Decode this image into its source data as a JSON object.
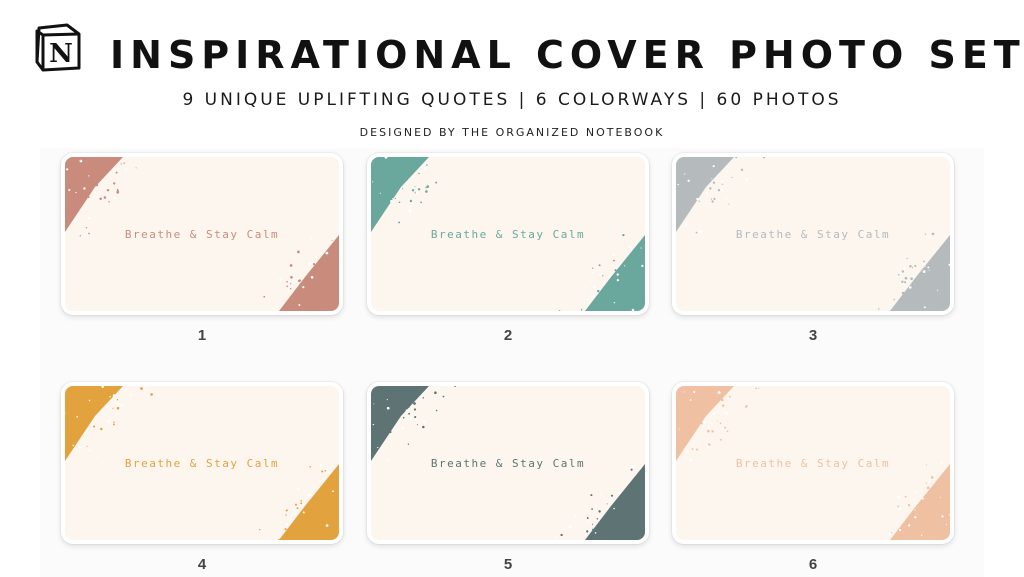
{
  "header": {
    "logo_letter": "N",
    "title": "INSPIRATIONAL COVER PHOTO SET",
    "subtitle": "9 UNIQUE UPLIFTING QUOTES | 6 COLORWAYS | 60 PHOTOS",
    "credit": "DESIGNED BY THE ORGANIZED NOTEBOOK"
  },
  "covers": [
    {
      "number": "1",
      "quote": "Breathe & Stay Calm",
      "accent": "#c98c7c",
      "text_color": "#c98c7c"
    },
    {
      "number": "2",
      "quote": "Breathe & Stay Calm",
      "accent": "#6aa89e",
      "text_color": "#6aa89e"
    },
    {
      "number": "3",
      "quote": "Breathe & Stay Calm",
      "accent": "#b5babd",
      "text_color": "#b5babd"
    },
    {
      "number": "4",
      "quote": "Breathe & Stay Calm",
      "accent": "#e2a23e",
      "text_color": "#e2a23e"
    },
    {
      "number": "5",
      "quote": "Breathe & Stay Calm",
      "accent": "#5e7374",
      "text_color": "#5e7374"
    },
    {
      "number": "6",
      "quote": "Breathe & Stay Calm",
      "accent": "#f0c0a2",
      "text_color": "#f0c0a2"
    }
  ],
  "colors": {
    "cover_background": "#fcf6ef"
  }
}
